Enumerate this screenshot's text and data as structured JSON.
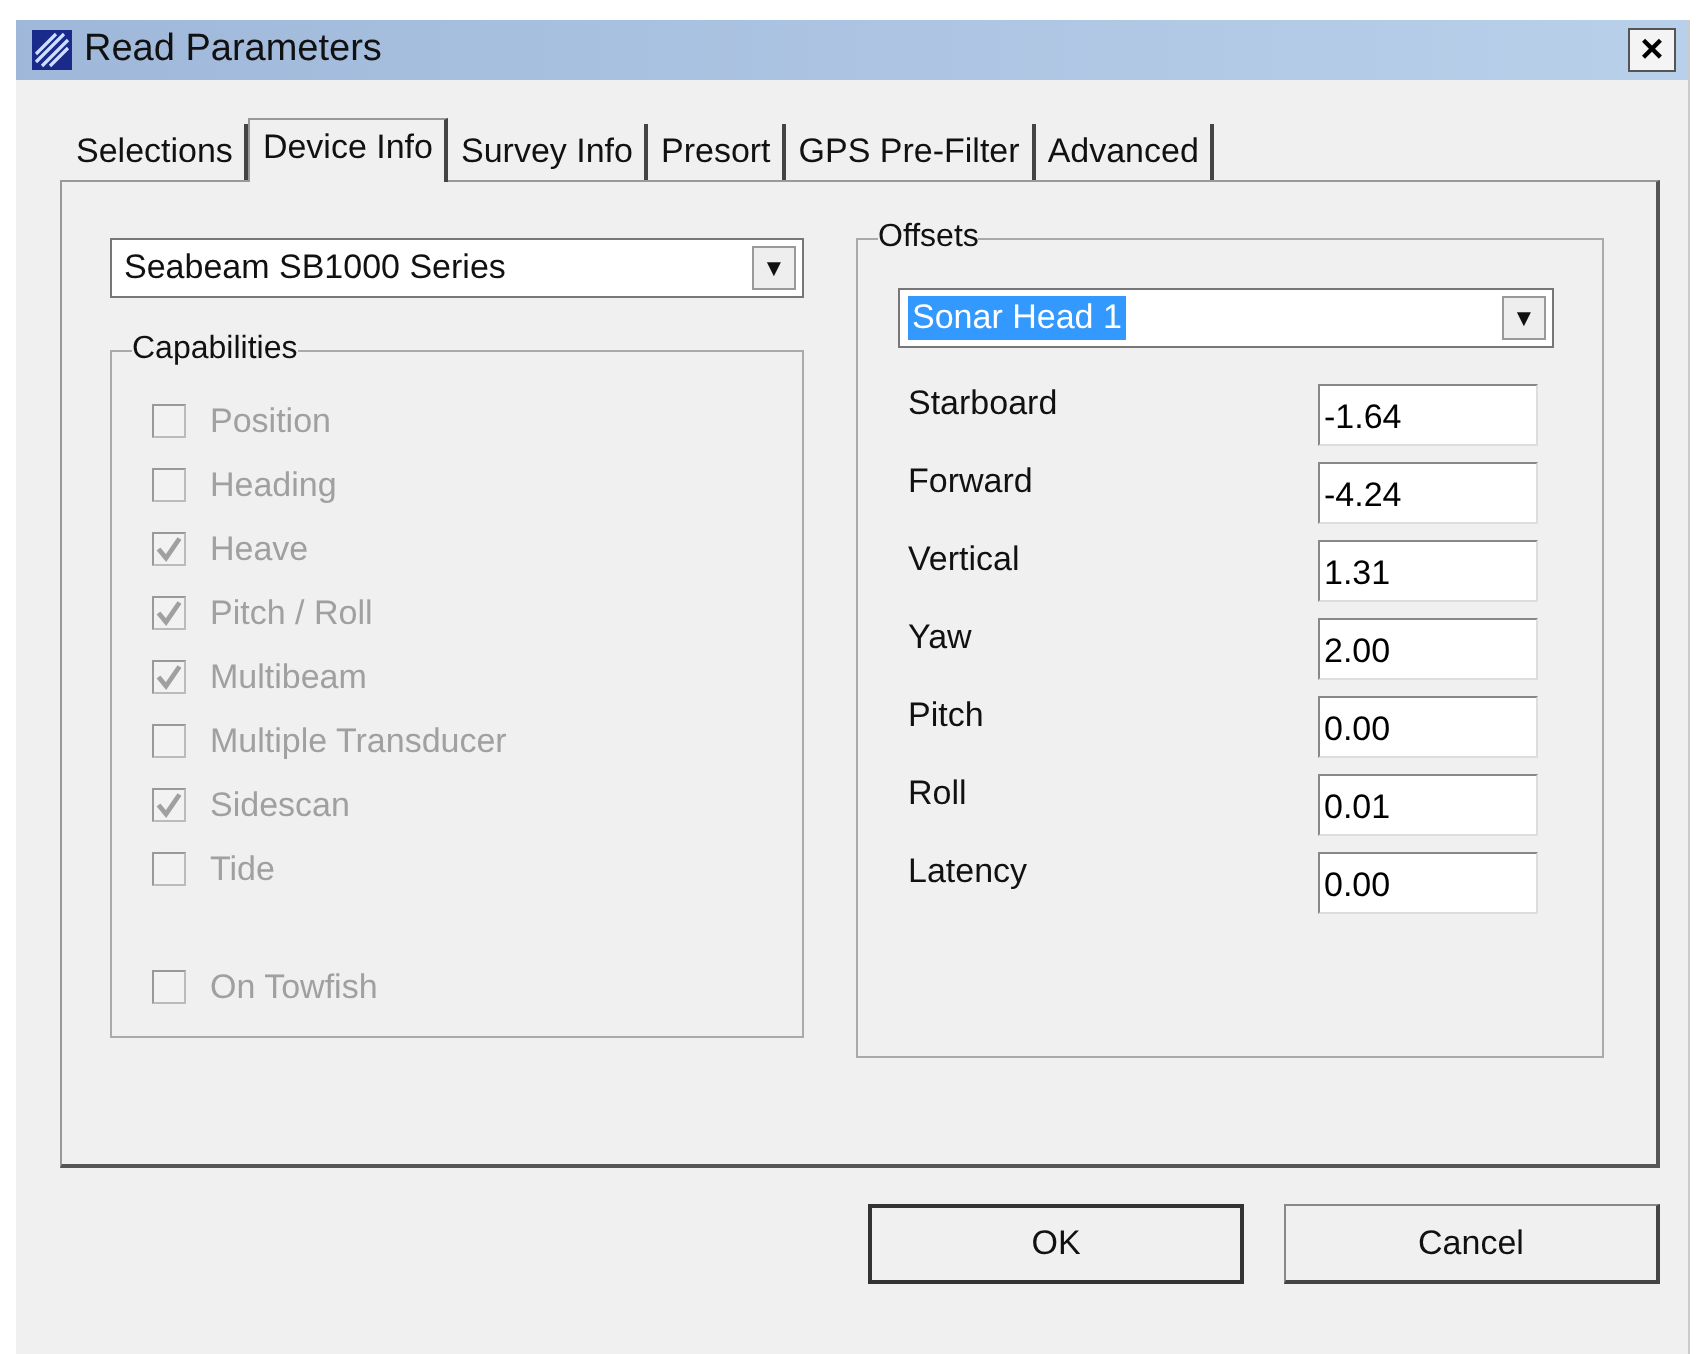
{
  "window": {
    "title": "Read Parameters",
    "close": "×"
  },
  "tabs": [
    {
      "label": "Selections",
      "selected": false
    },
    {
      "label": "Device Info",
      "selected": true
    },
    {
      "label": "Survey Info",
      "selected": false
    },
    {
      "label": "Presort",
      "selected": false
    },
    {
      "label": "GPS Pre-Filter",
      "selected": false
    },
    {
      "label": "Advanced",
      "selected": false
    }
  ],
  "device": {
    "value": "Seabeam SB1000 Series",
    "arrow": "▼"
  },
  "capabilities": {
    "title": "Capabilities",
    "items": [
      {
        "label": "Position",
        "checked": false,
        "disabled": true
      },
      {
        "label": "Heading",
        "checked": false,
        "disabled": true
      },
      {
        "label": "Heave",
        "checked": true,
        "disabled": true
      },
      {
        "label": "Pitch / Roll",
        "checked": true,
        "disabled": true
      },
      {
        "label": "Multibeam",
        "checked": true,
        "disabled": true
      },
      {
        "label": "Multiple Transducer",
        "checked": false,
        "disabled": true
      },
      {
        "label": "Sidescan",
        "checked": true,
        "disabled": true
      },
      {
        "label": "Tide",
        "checked": false,
        "disabled": true
      }
    ],
    "extra": [
      {
        "label": "On Towfish",
        "checked": false,
        "disabled": true
      }
    ]
  },
  "offsets": {
    "title": "Offsets",
    "sensor": {
      "value": "Sonar Head 1",
      "text_selected": true,
      "arrow": "▼"
    },
    "fields": [
      {
        "label": "Starboard",
        "value": "-1.64"
      },
      {
        "label": "Forward",
        "value": "-4.24"
      },
      {
        "label": "Vertical",
        "value": "1.31"
      },
      {
        "label": "Yaw",
        "value": "2.00"
      },
      {
        "label": "Pitch",
        "value": "0.00"
      },
      {
        "label": "Roll",
        "value": "0.01"
      },
      {
        "label": "Latency",
        "value": "0.00"
      }
    ]
  },
  "buttons": [
    "OK",
    "Cancel"
  ]
}
